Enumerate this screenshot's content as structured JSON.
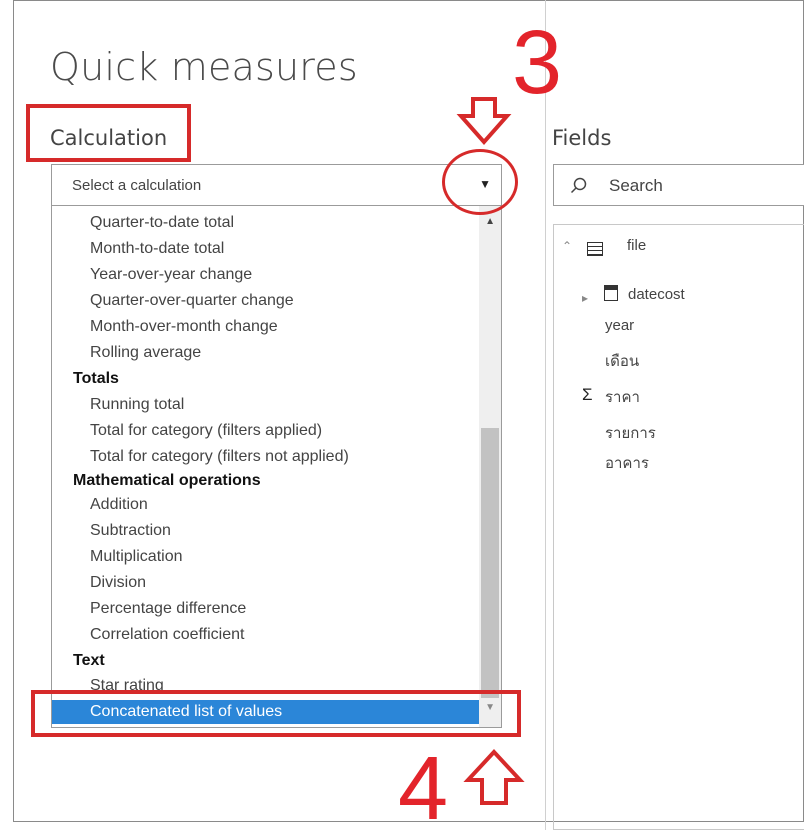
{
  "dialog": {
    "title": "Quick measures",
    "calculation_heading": "Calculation",
    "fields_heading": "Fields",
    "select_placeholder": "Select a calculation",
    "search_placeholder": "Search"
  },
  "dropdown": {
    "items": [
      {
        "text": "Quarter-to-date total",
        "kind": "option"
      },
      {
        "text": "Month-to-date total",
        "kind": "option"
      },
      {
        "text": "Year-over-year change",
        "kind": "option"
      },
      {
        "text": "Quarter-over-quarter change",
        "kind": "option"
      },
      {
        "text": "Month-over-month change",
        "kind": "option"
      },
      {
        "text": "Rolling average",
        "kind": "option"
      },
      {
        "text": "Totals",
        "kind": "group"
      },
      {
        "text": "Running total",
        "kind": "option"
      },
      {
        "text": "Total for category (filters applied)",
        "kind": "option"
      },
      {
        "text": "Total for category (filters not applied)",
        "kind": "option"
      },
      {
        "text": "Mathematical operations",
        "kind": "group"
      },
      {
        "text": "Addition",
        "kind": "option"
      },
      {
        "text": "Subtraction",
        "kind": "option"
      },
      {
        "text": "Multiplication",
        "kind": "option"
      },
      {
        "text": "Division",
        "kind": "option"
      },
      {
        "text": "Percentage difference",
        "kind": "option"
      },
      {
        "text": "Correlation coefficient",
        "kind": "option"
      },
      {
        "text": "Text",
        "kind": "group"
      },
      {
        "text": "Star rating",
        "kind": "option"
      },
      {
        "text": "Concatenated list of values",
        "kind": "option",
        "selected": true
      }
    ]
  },
  "fields": {
    "table_name": "file",
    "items": [
      {
        "text": "datecost",
        "icon": "calendar-icon",
        "expandable": true
      },
      {
        "text": "year"
      },
      {
        "text": "เดือน"
      },
      {
        "text": "ราคา",
        "icon": "sigma-icon"
      },
      {
        "text": "รายการ"
      },
      {
        "text": "อาคาร"
      }
    ]
  },
  "annotations": {
    "step3": "3",
    "step4": "4",
    "color": "#e3242b"
  },
  "colors": {
    "selection": "#2b86d8"
  }
}
